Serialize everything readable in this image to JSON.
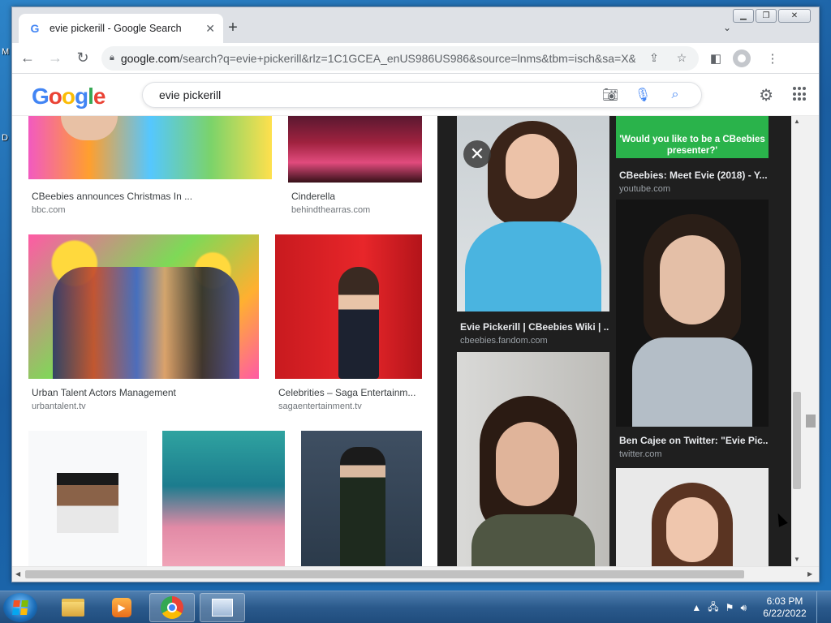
{
  "desktop": {
    "icon_labels": [
      "M",
      "D"
    ]
  },
  "browser": {
    "tab": {
      "title": "evie pickerill - Google Search",
      "favicon": "G"
    },
    "url": {
      "host": "google.com",
      "path": "/search?q=evie+pickerill&rlz=1C1GCEA_enUS986US986&source=lnms&tbm=isch&sa=X&ved..."
    }
  },
  "google": {
    "logo": [
      "G",
      "o",
      "o",
      "g",
      "l",
      "e"
    ],
    "query": "evie pickerill"
  },
  "results": [
    {
      "title": "CBeebies announces Christmas In ...",
      "source": "bbc.com"
    },
    {
      "title": "Cinderella",
      "source": "behindthearras.com"
    },
    {
      "title": "Urban Talent Actors Management",
      "source": "urbantalent.tv"
    },
    {
      "title": "Celebrities – Saga Entertainm...",
      "source": "sagaentertainment.tv"
    }
  ],
  "panel": {
    "items": [
      {
        "title": "Evie Pickerill | CBeebies Wiki | ...",
        "source": "cbeebies.fandom.com"
      },
      {
        "title": "CBeebies: Meet Evie (2018) - Y...",
        "source": "youtube.com",
        "overlay": "'Would you like to be a CBeebies presenter?'"
      },
      {
        "title": "Ben Cajee on Twitter: \"Evie Pic...",
        "source": "twitter.com"
      }
    ]
  },
  "taskbar": {
    "time": "6:03 PM",
    "date": "6/22/2022"
  }
}
